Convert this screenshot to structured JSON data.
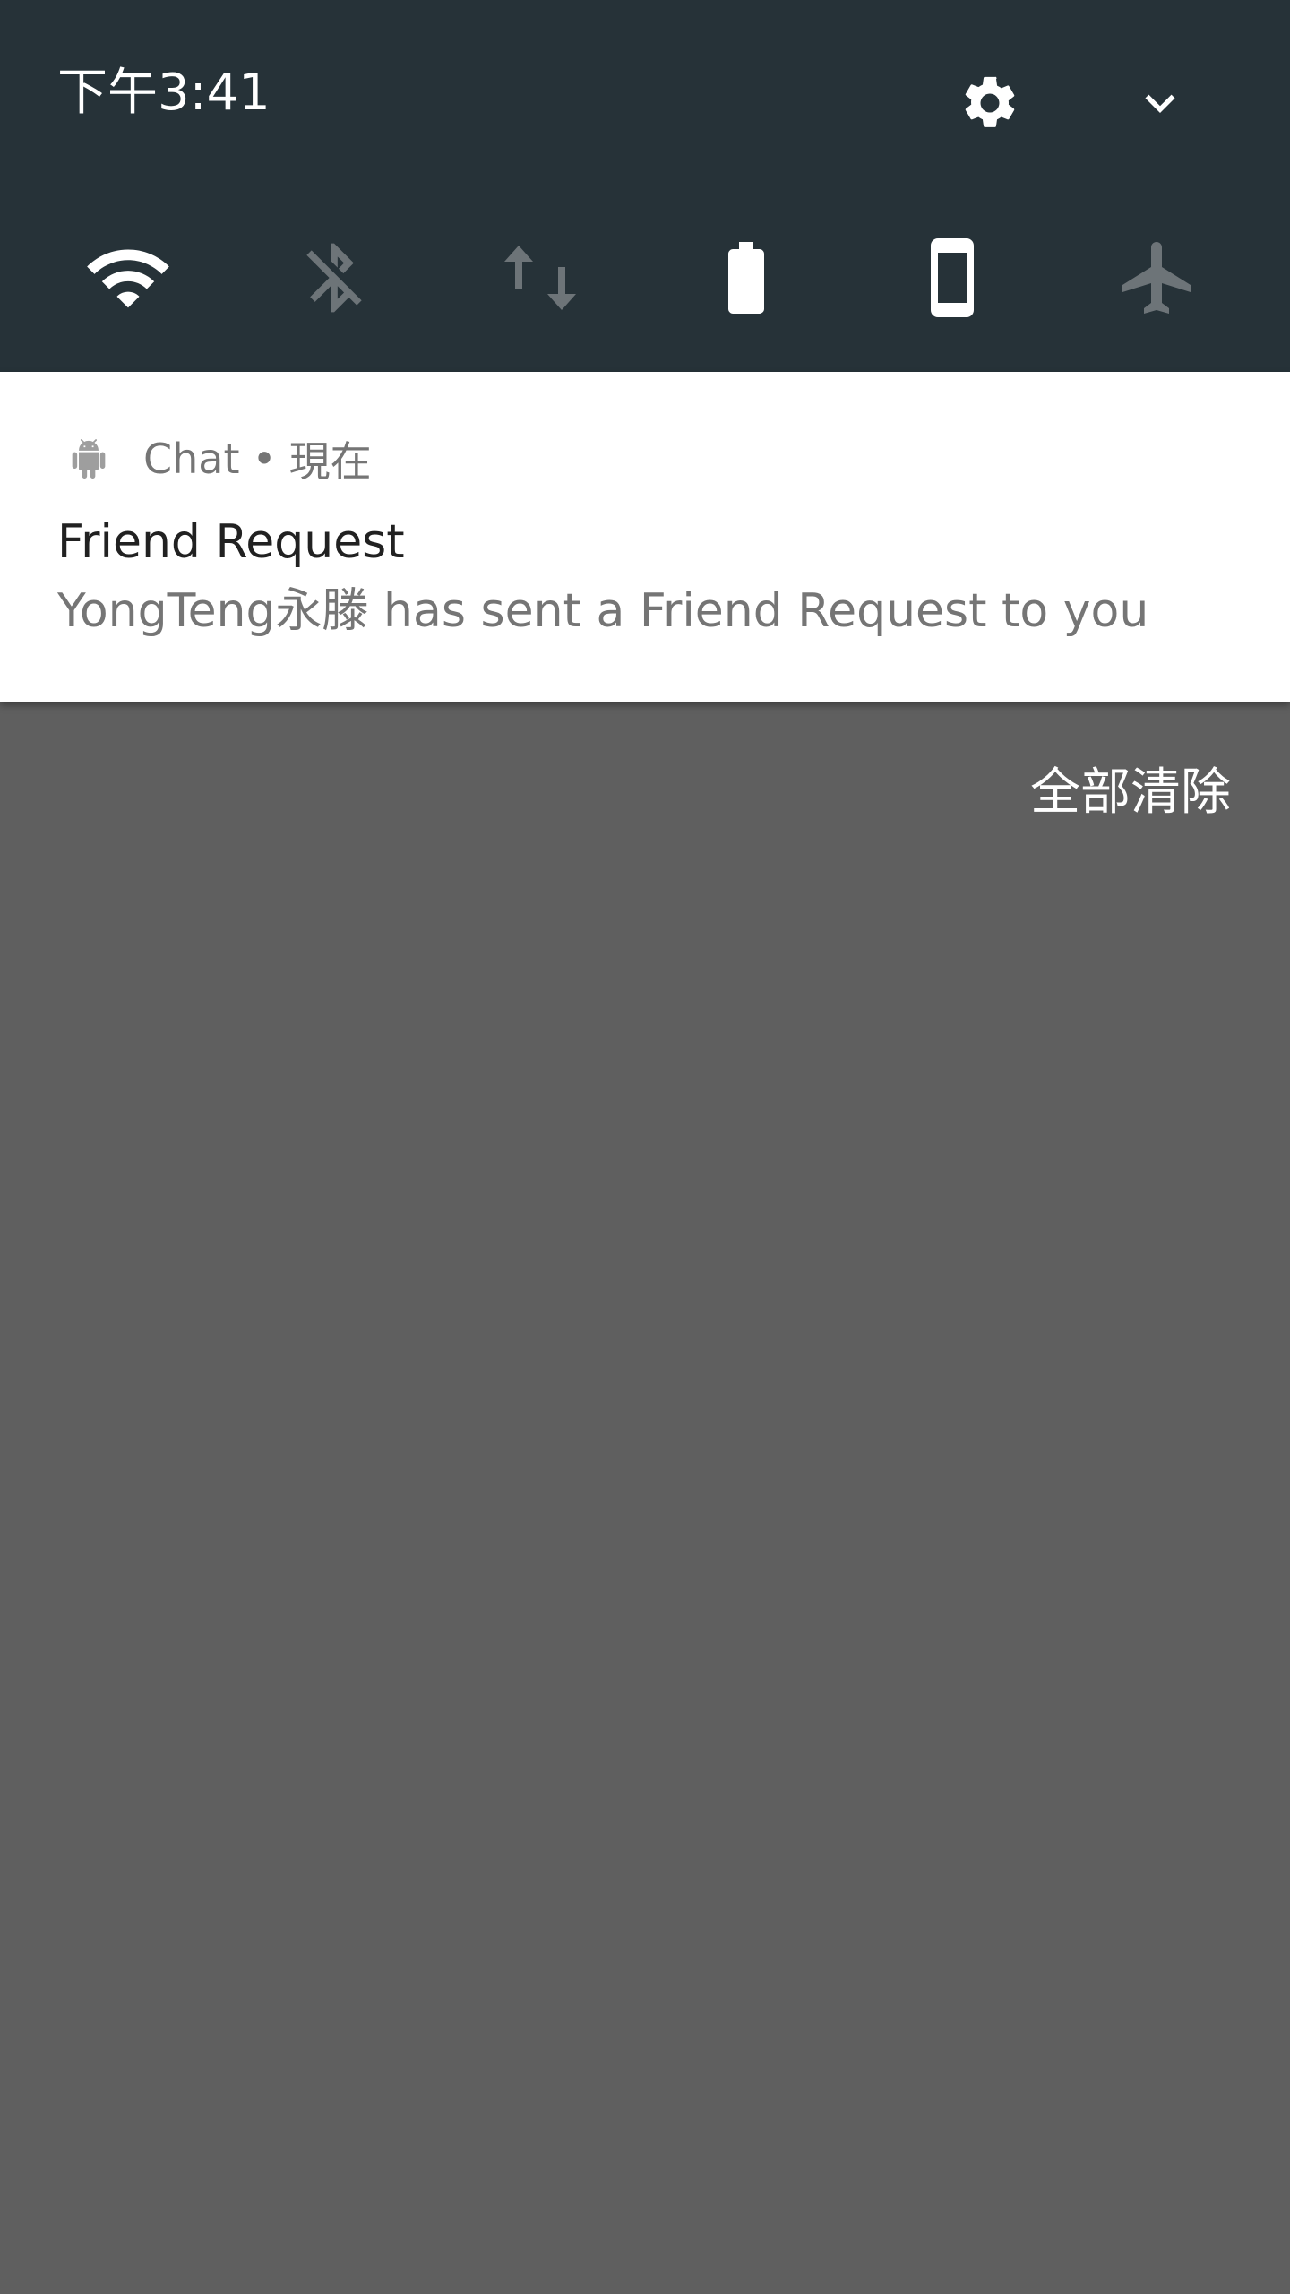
{
  "quick_settings": {
    "time": "下午3:41",
    "settings_icon": "gear-icon",
    "expand_icon": "chevron-down-icon",
    "tiles": [
      {
        "name": "wifi",
        "icon": "wifi-icon",
        "state": "on"
      },
      {
        "name": "bluetooth",
        "icon": "bluetooth-off-icon",
        "state": "off"
      },
      {
        "name": "mobile-data",
        "icon": "data-arrows-icon",
        "state": "off"
      },
      {
        "name": "battery",
        "icon": "battery-icon",
        "state": "on"
      },
      {
        "name": "auto-rotate",
        "icon": "phone-portrait-icon",
        "state": "on"
      },
      {
        "name": "airplane-mode",
        "icon": "airplane-icon",
        "state": "off"
      }
    ]
  },
  "notification": {
    "app_name": "Chat",
    "separator": "•",
    "time": "現在",
    "title": "Friend Request",
    "text": "YongTeng永滕 has sent a Friend Request to you",
    "app_icon": "android-icon"
  },
  "actions": {
    "clear_all": "全部清除"
  },
  "colors": {
    "panel_bg": "#263238",
    "notification_bg": "#ffffff",
    "scrim_bg": "#5f5f5f",
    "tile_on": "#ffffff",
    "tile_off": "#6d7478"
  }
}
